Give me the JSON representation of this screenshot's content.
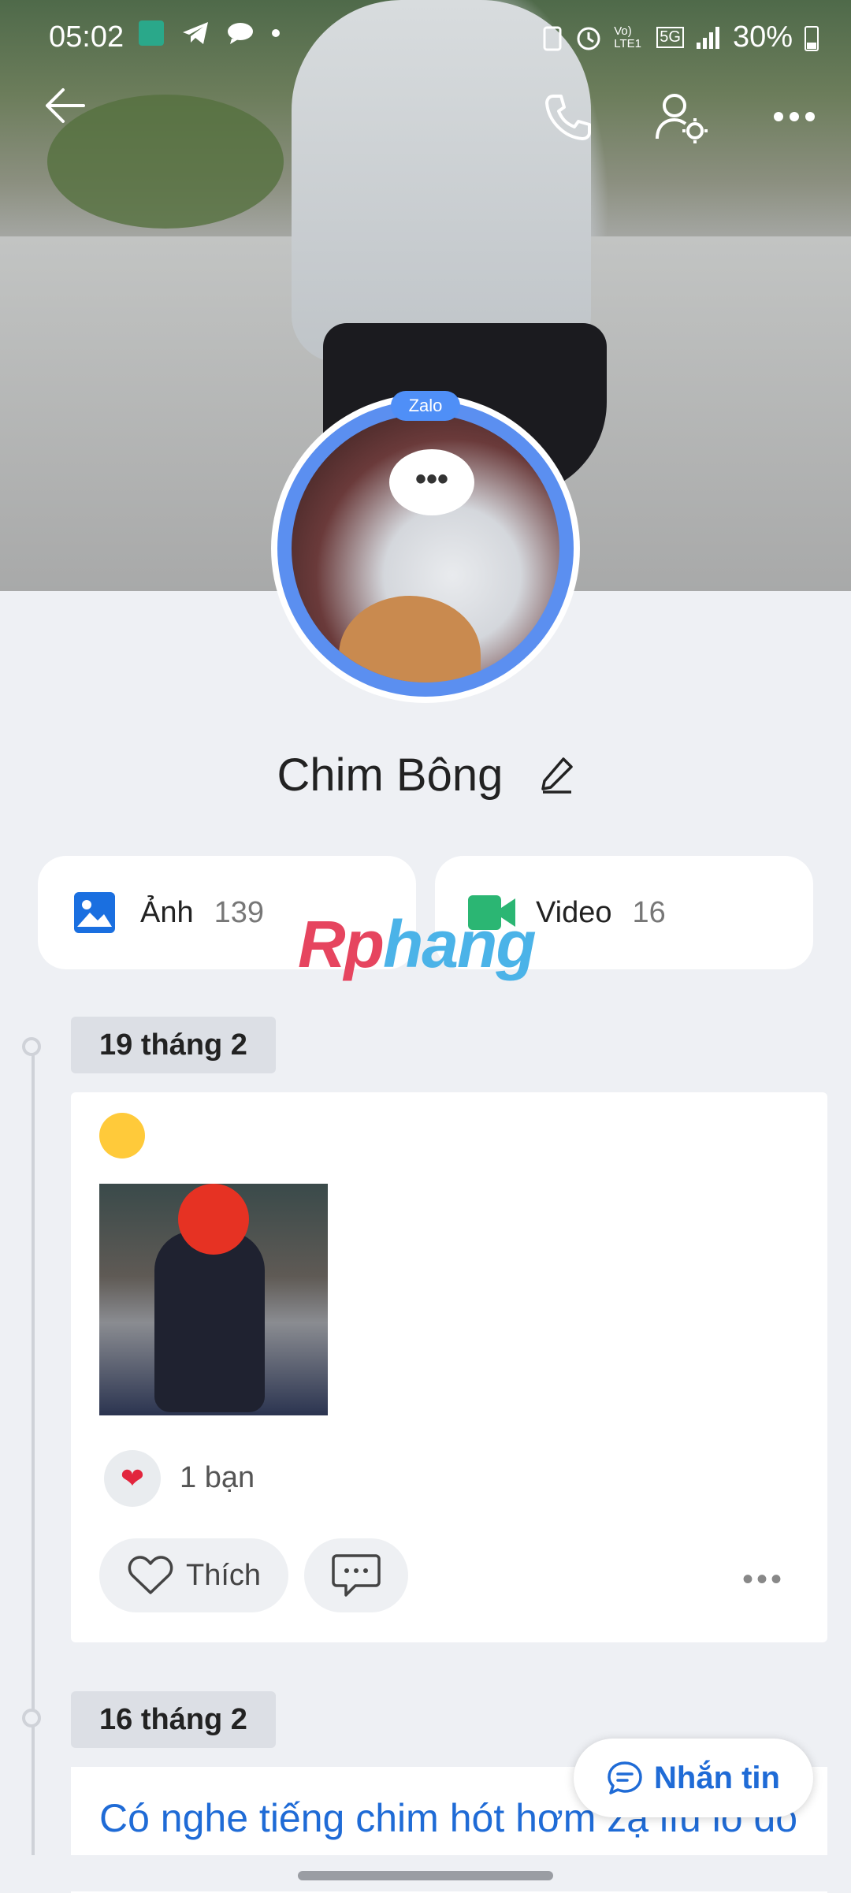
{
  "status_bar": {
    "time": "05:02",
    "battery": "30%",
    "network": "5G",
    "volte": "Vo) LTE1"
  },
  "header": {
    "back_icon": "arrow-left-icon",
    "call_icon": "phone-icon",
    "profile_settings_icon": "user-gear-icon",
    "more_icon": "more-horizontal-icon"
  },
  "profile": {
    "avatar_badge": "Zalo",
    "avatar_bubble": "•••",
    "name": "Chim Bông"
  },
  "media": {
    "photos_label": "Ảnh",
    "photos_count": "139",
    "video_label": "Video",
    "video_count": "16"
  },
  "watermark": {
    "part1": "Rp",
    "part2": "hang"
  },
  "posts": [
    {
      "date": "19 tháng 2",
      "reaction_count": "1 bạn",
      "like_label": "Thích",
      "more": "•••"
    },
    {
      "date": "16 tháng 2",
      "text": "Có nghe tiếng chim hót hơm zạ lìu lo đó"
    }
  ],
  "message_button": {
    "label": "Nhắn tin"
  },
  "colors": {
    "accent": "#1f6bd6",
    "avatar_ring": "#5b8ff0",
    "heart": "#e2253d"
  }
}
